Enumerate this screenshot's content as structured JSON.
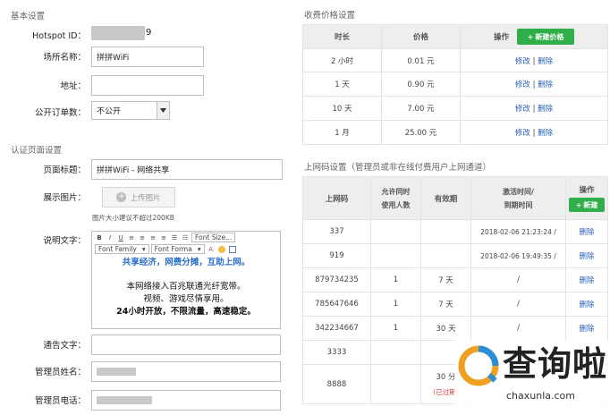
{
  "basic": {
    "section_title": "基本设置",
    "hotspot_label": "Hotspot ID：",
    "hotspot_suffix": "9",
    "venue_label": "场所名称：",
    "venue_value": "拼拼WiFi",
    "address_label": "地址：",
    "address_value": "",
    "public_orders_label": "公开订单数：",
    "public_orders_value": "不公开"
  },
  "auth": {
    "section_title": "认证页面设置",
    "page_title_label": "页面标题：",
    "page_title_value": "拼拼WiFi - 网络共享",
    "image_label": "展示图片：",
    "upload_label": "上传图片",
    "image_hint": "图片大小建议不超过200KB",
    "desc_label": "说明文字：",
    "toolbar": {
      "font_size": "Font Size...",
      "font_family": "Font Family",
      "font_format": "Font Forma"
    },
    "editor_lines": [
      "共享经济，网费分摊，互助上网。",
      "本网络接入百兆联通光纤宽带。",
      "视频、游戏尽情享用。",
      "24小时开放，不限流量，高速稳定。"
    ],
    "notice_label": "通告文字：",
    "admin_name_label": "管理员姓名：",
    "admin_phone_label": "管理员电话："
  },
  "pricing": {
    "section_title": "收费价格设置",
    "headers": {
      "duration": "时长",
      "price": "价格",
      "action": "操作"
    },
    "new_price_button": "新建价格",
    "edit_label": "修改",
    "separator": "|",
    "delete_label": "删除",
    "rows": [
      {
        "duration": "2 小时",
        "price": "0.01 元"
      },
      {
        "duration": "1 天",
        "price": "0.90 元"
      },
      {
        "duration": "10 天",
        "price": "7.00 元"
      },
      {
        "duration": "1 月",
        "price": "25.00 元"
      }
    ]
  },
  "codes": {
    "section_title": "上网码设置（管理员或非在线付费用户上网通道）",
    "headers": {
      "code": "上网码",
      "concurrent_line1": "允许同时",
      "concurrent_line2": "使用人数",
      "validity": "有效期",
      "time_line1": "激活时间/",
      "time_line2": "到期时间",
      "action": "操作"
    },
    "new_button": "新建",
    "delete_label": "删除",
    "rows": [
      {
        "code": "337",
        "users": "",
        "validity": "",
        "time": "2018-02-06 21:23:24 /"
      },
      {
        "code": "919",
        "users": "",
        "validity": "",
        "time": "2018-02-06 19:49:35 /"
      },
      {
        "code": "879734235",
        "users": "1",
        "validity": "7 天",
        "time": "/"
      },
      {
        "code": "785647646",
        "users": "1",
        "validity": "7 天",
        "time": "/"
      },
      {
        "code": "342234667",
        "users": "1",
        "validity": "30 天",
        "time": "/"
      },
      {
        "code": "3333",
        "users": "",
        "validity": "",
        "time": ""
      },
      {
        "code": "8888",
        "users": "",
        "validity": "30 分",
        "time": ""
      }
    ],
    "expired_label": "（已过期）"
  },
  "watermark": {
    "brand": "查询啦",
    "url": "chaxunla.com"
  },
  "colors": {
    "green": "#2fae49",
    "link": "#2a63b8",
    "editor_blue": "#2a6fc9",
    "expired_red": "#d23c3c"
  }
}
